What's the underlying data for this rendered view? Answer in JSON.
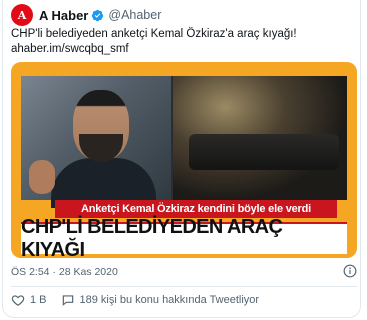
{
  "tweet": {
    "author_name": "A Haber",
    "author_handle": "@Ahaber",
    "avatar_initial": "A",
    "text": "CHP'li belediyeden anketçi Kemal Özkiraz'a araç kıyağı!",
    "link": "ahaber.im/swcqbq_smf",
    "timestamp": "ÖS 2:54 · 28 Kas 2020",
    "like_count": "1 B",
    "reply_text": "189 kişi bu konu hakkında Tweetliyor"
  },
  "media": {
    "caption": "Anketçi Kemal Özkiraz kendini böyle ele verdi",
    "headline": "CHP'Lİ BELEDİYEDEN ARAÇ KIYAĞI"
  },
  "colors": {
    "brand_red": "#e30a17",
    "media_frame": "#f5a623",
    "verified_blue": "#1d9bf0"
  },
  "icons": {
    "verified": "verified-badge-icon",
    "info": "info-icon",
    "like": "heart-icon",
    "reply": "speech-bubble-icon"
  }
}
